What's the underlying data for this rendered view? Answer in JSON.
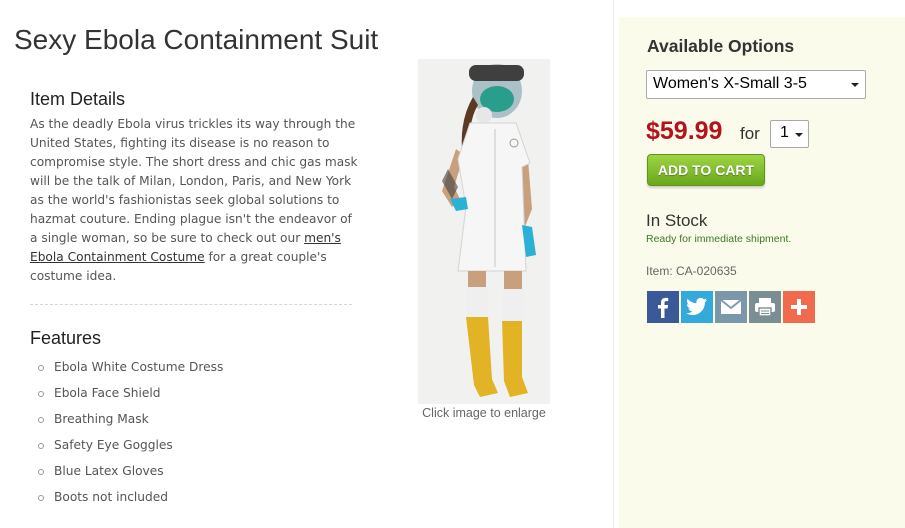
{
  "product": {
    "title": "Sexy Ebola Containment Suit",
    "details_heading": "Item Details",
    "description_before_link": "As the deadly Ebola virus trickles its way through the United States, fighting its disease is no reason to compromise style. The short dress and chic gas mask will be the talk of Milan, London, Paris, and New York as the world's fashionistas seek global solutions to hazmat couture. Ending plague isn't the endeavor of a single woman, so be sure to check out our ",
    "description_link": "men's Ebola Containment Costume",
    "description_after_link": " for a great couple's costume idea.",
    "features_heading": "Features",
    "features": [
      "Ebola White Costume Dress",
      "Ebola Face Shield",
      "Breathing Mask",
      "Safety Eye Goggles",
      "Blue Latex Gloves",
      "Boots not included"
    ],
    "image_caption": "Click image to enlarge"
  },
  "options": {
    "heading": "Available Options",
    "size_selected": "Women's X-Small 3-5",
    "price": "$59.99",
    "for_label": "for",
    "quantity": "1",
    "add_to_cart": "ADD TO CART",
    "stock_status": "In Stock",
    "stock_note": "Ready for immediate shipment.",
    "item_number": "Item: CA-020635",
    "share_icons": [
      "facebook-icon",
      "twitter-icon",
      "email-icon",
      "print-icon",
      "add-icon"
    ]
  },
  "colors": {
    "price": "#b5121b",
    "add_to_cart": "#7cbf2a",
    "panel_bg": "#fbfbec",
    "stock_note": "#3c7a23"
  }
}
